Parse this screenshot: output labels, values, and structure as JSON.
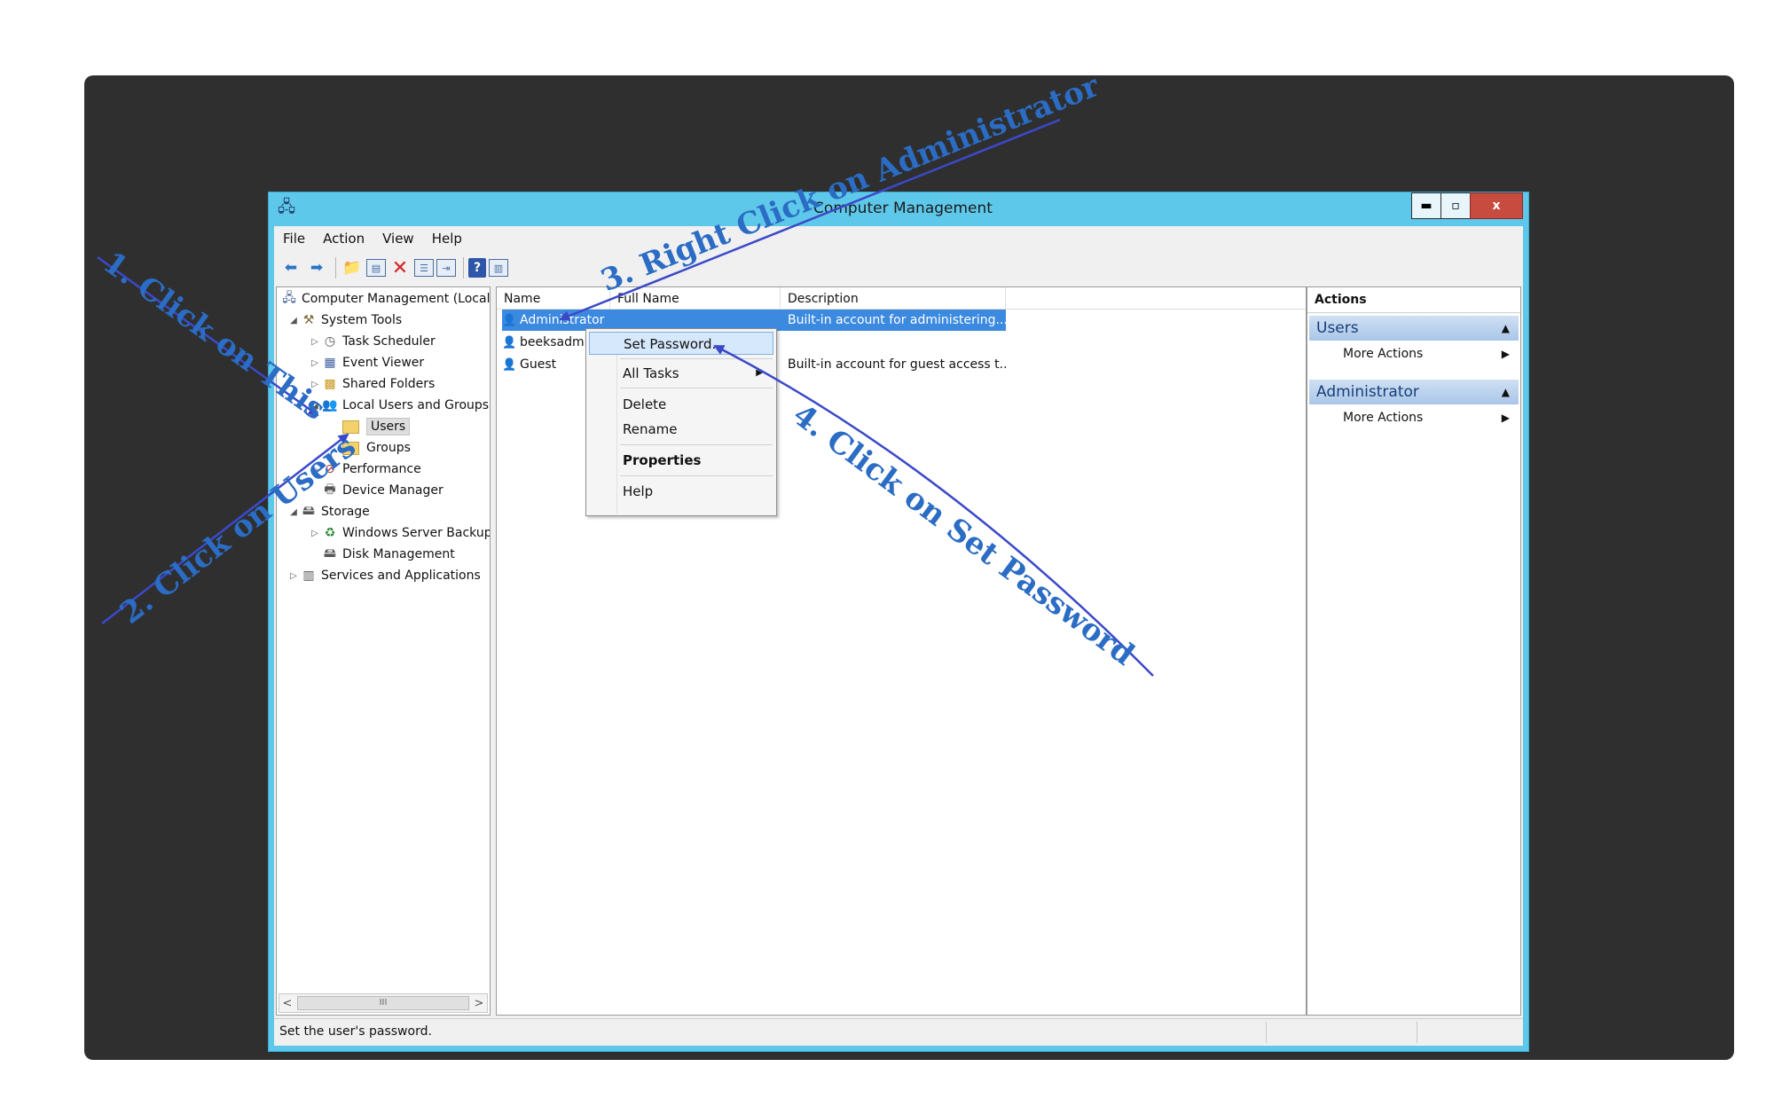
{
  "window": {
    "title": "Computer Management",
    "buttons": {
      "minimize": "▬",
      "maximize": "▫",
      "close": "x"
    }
  },
  "menu": [
    "File",
    "Action",
    "View",
    "Help"
  ],
  "tree": {
    "items": [
      {
        "label": "Computer Management (Local",
        "icon": "computer-management-icon"
      },
      {
        "label": "System Tools",
        "icon": "tools-icon"
      },
      {
        "label": "Task Scheduler",
        "icon": "clock-icon"
      },
      {
        "label": "Event Viewer",
        "icon": "event-viewer-icon"
      },
      {
        "label": "Shared Folders",
        "icon": "shared-folder-icon"
      },
      {
        "label": "Local Users and Groups",
        "icon": "users-group-icon"
      },
      {
        "label": "Users",
        "icon": "folder-icon"
      },
      {
        "label": "Groups",
        "icon": "folder-icon"
      },
      {
        "label": "Performance",
        "icon": "performance-icon"
      },
      {
        "label": "Device Manager",
        "icon": "device-manager-icon"
      },
      {
        "label": "Storage",
        "icon": "storage-icon"
      },
      {
        "label": "Windows Server Backup",
        "icon": "backup-icon"
      },
      {
        "label": "Disk Management",
        "icon": "disk-icon"
      },
      {
        "label": "Services and Applications",
        "icon": "services-icon"
      }
    ],
    "scroll_thumb": "III"
  },
  "list": {
    "columns": [
      "Name",
      "Full Name",
      "Description"
    ],
    "rows": [
      {
        "name": "Administrator",
        "full_name": "",
        "description": "Built-in account for administering..."
      },
      {
        "name": "beeksadmi",
        "full_name": "",
        "description": ""
      },
      {
        "name": "Guest",
        "full_name": "",
        "description": "Built-in account for guest access t..."
      }
    ]
  },
  "context_menu": {
    "items": [
      "Set Password...",
      "All Tasks",
      "Delete",
      "Rename",
      "Properties",
      "Help"
    ]
  },
  "actions": {
    "title": "Actions",
    "sections": [
      {
        "label": "Users",
        "item": "More Actions"
      },
      {
        "label": "Administrator",
        "item": "More Actions"
      }
    ]
  },
  "status": {
    "text": "Set the user's password."
  },
  "annotations": [
    "1. Click on This",
    "2. Click on Users",
    "3. Right Click on Administrator",
    "4. Click on Set Password"
  ],
  "colors": {
    "accent": "#3c8ae0",
    "annotation": "#2b6cc4",
    "window_frame": "#5ec8ea",
    "close_button": "#c74b3f"
  }
}
